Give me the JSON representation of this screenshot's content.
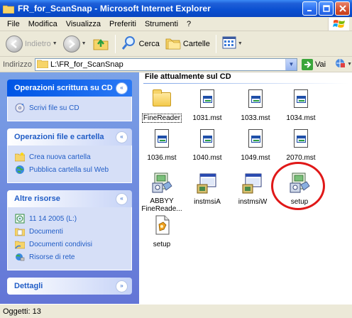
{
  "window": {
    "title": "FR_for_ScanSnap - Microsoft Internet Explorer"
  },
  "menu": {
    "items": [
      "File",
      "Modifica",
      "Visualizza",
      "Preferiti",
      "Strumenti",
      "?"
    ]
  },
  "toolbar": {
    "back_label": "Indietro",
    "search_label": "Cerca",
    "folders_label": "Cartelle"
  },
  "address": {
    "label": "Indirizzo",
    "value": "L:\\FR_for_ScanSnap",
    "go_label": "Vai"
  },
  "leftpane": {
    "groups": [
      {
        "title": "Operazioni scrittura su CD",
        "collapse": "«",
        "tasks": [
          {
            "label": "Scrivi file su CD",
            "icon": "cd-write-icon"
          }
        ]
      },
      {
        "title": "Operazioni file e cartella",
        "collapse": "«",
        "tasks": [
          {
            "label": "Crea nuova cartella",
            "icon": "new-folder-icon"
          },
          {
            "label": "Pubblica cartella sul Web",
            "icon": "publish-web-icon"
          }
        ]
      },
      {
        "title": "Altre risorse",
        "collapse": "«",
        "tasks": [
          {
            "label": "11 14 2005 (L:)",
            "icon": "cd-drive-icon"
          },
          {
            "label": "Documenti",
            "icon": "documents-folder-icon"
          },
          {
            "label": "Documenti condivisi",
            "icon": "shared-folder-icon"
          },
          {
            "label": "Risorse di rete",
            "icon": "network-icon"
          }
        ]
      },
      {
        "title": "Dettagli",
        "collapse": "»",
        "tasks": []
      }
    ]
  },
  "content": {
    "section_title": "File attualmente sul CD",
    "files": [
      {
        "name": "FineReader",
        "type": "folder"
      },
      {
        "name": "1031.mst",
        "type": "doc"
      },
      {
        "name": "1033.mst",
        "type": "doc"
      },
      {
        "name": "1034.mst",
        "type": "doc"
      },
      {
        "name": "1036.mst",
        "type": "doc"
      },
      {
        "name": "1040.mst",
        "type": "doc"
      },
      {
        "name": "1049.mst",
        "type": "doc"
      },
      {
        "name": "2070.mst",
        "type": "doc"
      },
      {
        "name": "ABBYY FineReade...",
        "type": "installer"
      },
      {
        "name": "instmsiA",
        "type": "exe"
      },
      {
        "name": "instmsiW",
        "type": "exe"
      },
      {
        "name": "setup",
        "type": "installer"
      },
      {
        "name": "setup",
        "type": "config"
      }
    ]
  },
  "status": {
    "text": "Oggetti: 13"
  },
  "colors": {
    "titlebar": "#0a4fd0",
    "taskpane": "#6e8fe0",
    "link": "#215dc6",
    "annotation": "#e01818"
  }
}
